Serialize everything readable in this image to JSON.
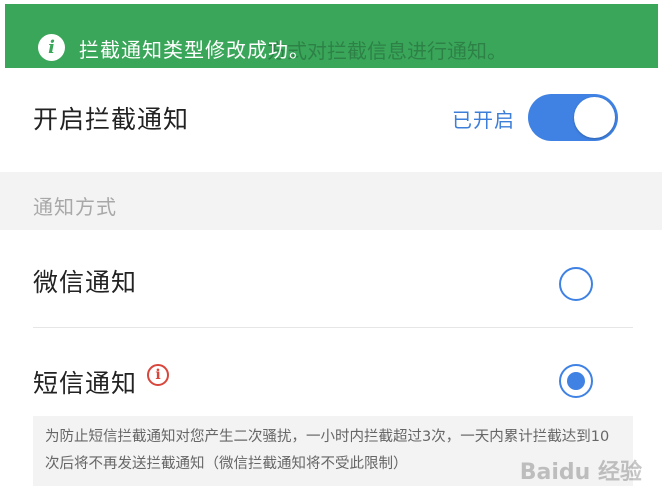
{
  "toast": {
    "message": "拦截通知类型修改成功。",
    "behind_text": "方式对拦截信息进行通知。",
    "icon": "info-icon",
    "color": "#3aa65a"
  },
  "intercept_toggle": {
    "label": "开启拦截通知",
    "status": "已开启",
    "on": true,
    "accent": "#3f82e4"
  },
  "notify_section": {
    "title": "通知方式"
  },
  "options": [
    {
      "label": "微信通知",
      "selected": false
    },
    {
      "label": "短信通知",
      "selected": true,
      "icon": "info-circle-icon",
      "icon_color": "#d9463c"
    }
  ],
  "notice": {
    "text": "为防止短信拦截通知对您产生二次骚扰，一小时内拦截超过3次，一天内累计拦截达到10次后将不再发送拦截通知（微信拦截通知将不受此限制）"
  },
  "watermark": "Baidu 经验"
}
